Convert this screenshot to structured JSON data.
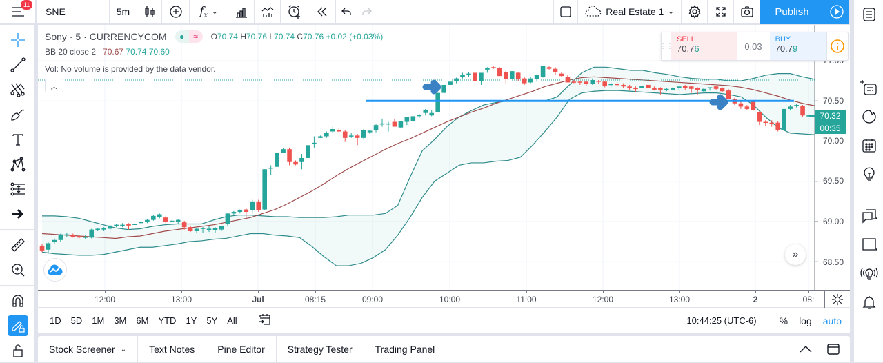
{
  "topbar": {
    "notification_count": "11",
    "symbol": "SNE",
    "interval": "5m",
    "layout_name": "Real Estate 1",
    "publish_label": "Publish"
  },
  "legend": {
    "title": "Sony · 5 · CURRENCYCOM",
    "ohlc": {
      "o_label": "O",
      "o": "70.74",
      "h_label": "H",
      "h": "70.76",
      "l_label": "L",
      "l": "70.74",
      "c_label": "C",
      "c": "70.76",
      "change": "+0.02 (+0.03%)"
    },
    "bb_label": "BB 20 close 2",
    "bb_values": [
      "70.67",
      "70.74",
      "70.60"
    ],
    "vol_text": "Vol: No volume is provided by the data vendor."
  },
  "trade": {
    "sell_label": "SELL",
    "sell_price_main": "70.7",
    "sell_price_last": "6",
    "spread": "0.03",
    "buy_label": "BUY",
    "buy_price_main": "70.7",
    "buy_price_last": "9",
    "zoom_in": "+",
    "zoom_out": "−"
  },
  "price_axis": {
    "labels": [
      "71.00",
      "70.50",
      "70.00",
      "69.50",
      "69.00",
      "68.50"
    ],
    "last_price": "70.32",
    "countdown": "00:35"
  },
  "time_axis": {
    "labels": [
      "12:00",
      "13:00",
      "Jul",
      "08:15",
      "09:00",
      "10:00",
      "11:00",
      "12:00",
      "13:00",
      "2",
      "08:"
    ]
  },
  "bottom": {
    "ranges": [
      "1D",
      "5D",
      "1M",
      "3M",
      "6M",
      "YTD",
      "1Y",
      "5Y",
      "All"
    ],
    "clock": "10:44:25 (UTC-6)",
    "percent": "%",
    "log": "log",
    "auto": "auto"
  },
  "panel_tabs": [
    "Stock Screener",
    "Text Notes",
    "Pine Editor",
    "Strategy Tester",
    "Trading Panel"
  ],
  "colors": {
    "up": "#26a69a",
    "down": "#ef5350",
    "accent": "#2196f3",
    "bb_basis": "#a04b4b",
    "bb_band": "#2e8b8b"
  },
  "chart_data": {
    "type": "candlestick",
    "title": "Sony · 5 · CURRENCYCOM",
    "ylim": [
      68.3,
      71.15
    ],
    "y_ticks": [
      71.0,
      70.5,
      70.0,
      69.5,
      69.0,
      68.5
    ],
    "horizontal_line": 70.5,
    "candles": [
      [
        68.7,
        68.72,
        68.62,
        68.64
      ],
      [
        68.65,
        68.74,
        68.6,
        68.73
      ],
      [
        68.75,
        68.79,
        68.72,
        68.77
      ],
      [
        68.77,
        68.85,
        68.75,
        68.84
      ],
      [
        68.83,
        68.86,
        68.81,
        68.84
      ],
      [
        68.83,
        68.85,
        68.8,
        68.81
      ],
      [
        68.82,
        68.83,
        68.79,
        68.8
      ],
      [
        68.8,
        68.83,
        68.78,
        68.81
      ],
      [
        68.8,
        68.91,
        68.79,
        68.9
      ],
      [
        68.9,
        68.92,
        68.88,
        68.91
      ],
      [
        68.9,
        68.93,
        68.88,
        68.92
      ],
      [
        68.91,
        68.95,
        68.85,
        68.95
      ],
      [
        68.95,
        68.97,
        68.93,
        68.96
      ],
      [
        68.96,
        68.98,
        68.93,
        68.96
      ],
      [
        68.97,
        68.98,
        68.9,
        68.95
      ],
      [
        68.96,
        68.98,
        68.94,
        68.97
      ],
      [
        68.98,
        69.01,
        68.96,
        69.0
      ],
      [
        69.0,
        69.03,
        68.98,
        69.02
      ],
      [
        69.02,
        69.08,
        69.01,
        69.07
      ],
      [
        69.06,
        69.1,
        69.04,
        69.09
      ],
      [
        69.05,
        69.07,
        68.98,
        69.0
      ],
      [
        69.0,
        69.02,
        68.99,
        69.01
      ],
      [
        69.0,
        69.03,
        68.97,
        69.02
      ],
      [
        68.99,
        69.01,
        68.9,
        68.93
      ],
      [
        68.93,
        68.95,
        68.87,
        68.88
      ],
      [
        68.88,
        68.92,
        68.86,
        68.91
      ],
      [
        68.91,
        68.93,
        68.86,
        68.92
      ],
      [
        68.9,
        68.94,
        68.87,
        68.91
      ],
      [
        68.89,
        68.93,
        68.86,
        68.92
      ],
      [
        68.9,
        68.95,
        68.88,
        68.94
      ],
      [
        68.97,
        69.1,
        68.95,
        69.1
      ],
      [
        69.1,
        69.13,
        69.08,
        69.12
      ],
      [
        69.12,
        69.15,
        69.1,
        69.14
      ],
      [
        69.15,
        69.17,
        69.05,
        69.12
      ],
      [
        69.14,
        69.27,
        69.11,
        69.25
      ],
      [
        69.25,
        69.27,
        69.12,
        69.14
      ],
      [
        69.15,
        69.65,
        69.14,
        69.65
      ],
      [
        69.66,
        69.7,
        69.58,
        69.67
      ],
      [
        69.68,
        69.85,
        69.68,
        69.85
      ],
      [
        69.85,
        69.91,
        69.85,
        69.9
      ],
      [
        69.9,
        69.92,
        69.7,
        69.74
      ],
      [
        69.74,
        69.76,
        69.7,
        69.71
      ],
      [
        69.74,
        69.84,
        69.65,
        69.79
      ],
      [
        69.79,
        69.95,
        69.79,
        69.95
      ],
      [
        69.98,
        70.06,
        69.92,
        69.98
      ],
      [
        70.04,
        70.07,
        70.04,
        70.06
      ],
      [
        70.06,
        70.12,
        70.04,
        70.1
      ],
      [
        70.12,
        70.18,
        70.1,
        70.15
      ],
      [
        70.14,
        70.17,
        70.11,
        70.12
      ],
      [
        70.12,
        70.14,
        69.99,
        70.04
      ],
      [
        70.06,
        70.1,
        70.04,
        70.07
      ],
      [
        70.07,
        70.09,
        69.95,
        70.04
      ],
      [
        70.04,
        70.15,
        70.02,
        70.14
      ],
      [
        70.11,
        70.14,
        70.09,
        70.13
      ],
      [
        70.14,
        70.21,
        70.11,
        70.2
      ],
      [
        70.22,
        70.28,
        70.18,
        70.22
      ],
      [
        70.22,
        70.24,
        70.12,
        70.22
      ],
      [
        70.24,
        70.28,
        70.18,
        70.18
      ],
      [
        70.17,
        70.25,
        70.16,
        70.25
      ],
      [
        70.24,
        70.26,
        70.2,
        70.3
      ],
      [
        70.25,
        70.3,
        70.24,
        70.31
      ],
      [
        70.31,
        70.34,
        70.29,
        70.33
      ],
      [
        70.35,
        70.4,
        70.32,
        70.39
      ],
      [
        70.32,
        70.39,
        70.31,
        70.35
      ],
      [
        70.36,
        70.6,
        70.36,
        70.6
      ],
      [
        70.6,
        70.7,
        70.59,
        70.7
      ],
      [
        70.7,
        70.75,
        70.7,
        70.74
      ],
      [
        70.75,
        70.79,
        70.72,
        70.78
      ],
      [
        70.8,
        70.85,
        70.78,
        70.82
      ],
      [
        70.84,
        70.86,
        70.8,
        70.84
      ],
      [
        70.85,
        70.85,
        70.7,
        70.75
      ],
      [
        70.75,
        70.84,
        70.7,
        70.85
      ],
      [
        70.89,
        70.92,
        70.85,
        70.91
      ],
      [
        70.92,
        70.93,
        70.9,
        70.91
      ],
      [
        70.91,
        70.92,
        70.81,
        70.81
      ],
      [
        70.86,
        70.88,
        70.72,
        70.77
      ],
      [
        70.77,
        70.87,
        70.77,
        70.87
      ],
      [
        70.85,
        70.86,
        70.75,
        70.77
      ],
      [
        70.78,
        70.8,
        70.7,
        70.72
      ],
      [
        70.73,
        70.8,
        70.72,
        70.78
      ],
      [
        70.77,
        70.83,
        70.74,
        70.82
      ],
      [
        70.8,
        70.94,
        70.79,
        70.94
      ],
      [
        70.92,
        70.93,
        70.89,
        70.9
      ],
      [
        70.9,
        70.92,
        70.82,
        70.86
      ],
      [
        70.84,
        70.86,
        70.8,
        70.81
      ],
      [
        70.8,
        70.82,
        70.73,
        70.73
      ],
      [
        70.74,
        70.76,
        70.72,
        70.73
      ],
      [
        70.74,
        70.75,
        70.7,
        70.73
      ],
      [
        70.74,
        70.75,
        70.69,
        70.71
      ],
      [
        70.71,
        70.78,
        70.7,
        70.76
      ],
      [
        70.75,
        70.76,
        70.71,
        70.74
      ],
      [
        70.74,
        70.75,
        70.67,
        70.69
      ],
      [
        70.7,
        70.73,
        70.67,
        70.71
      ],
      [
        70.71,
        70.73,
        70.68,
        70.7
      ],
      [
        70.7,
        70.72,
        70.66,
        70.68
      ],
      [
        70.68,
        70.7,
        70.63,
        70.66
      ],
      [
        70.66,
        70.68,
        70.61,
        70.65
      ],
      [
        70.66,
        70.71,
        70.64,
        70.69
      ],
      [
        70.7,
        70.71,
        70.59,
        70.66
      ],
      [
        70.66,
        70.68,
        70.63,
        70.64
      ],
      [
        70.66,
        70.67,
        70.58,
        70.64
      ],
      [
        70.64,
        70.66,
        70.62,
        70.65
      ],
      [
        70.64,
        70.67,
        70.63,
        70.66
      ],
      [
        70.66,
        70.68,
        70.63,
        70.68
      ],
      [
        70.69,
        70.7,
        70.64,
        70.66
      ],
      [
        70.68,
        70.69,
        70.6,
        70.65
      ],
      [
        70.66,
        70.67,
        70.58,
        70.64
      ],
      [
        70.62,
        70.66,
        70.61,
        70.65
      ],
      [
        70.66,
        70.67,
        70.63,
        70.67
      ],
      [
        70.68,
        70.69,
        70.64,
        70.65
      ],
      [
        70.66,
        70.67,
        70.61,
        70.62
      ],
      [
        70.63,
        70.65,
        70.55,
        70.52
      ],
      [
        70.52,
        70.54,
        70.45,
        70.47
      ],
      [
        70.47,
        70.49,
        70.4,
        70.43
      ],
      [
        70.43,
        70.45,
        70.39,
        70.4
      ],
      [
        70.49,
        70.5,
        70.38,
        70.39
      ],
      [
        70.36,
        70.37,
        70.2,
        70.24
      ],
      [
        70.24,
        70.26,
        70.19,
        70.23
      ],
      [
        70.23,
        70.26,
        70.18,
        70.22
      ],
      [
        70.23,
        70.25,
        70.12,
        70.14
      ],
      [
        70.14,
        70.4,
        70.13,
        70.4
      ],
      [
        70.4,
        70.45,
        70.38,
        70.43
      ],
      [
        70.44,
        70.46,
        70.42,
        70.45
      ],
      [
        70.44,
        70.45,
        70.3,
        70.32
      ],
      [
        70.32,
        70.33,
        70.31,
        70.32
      ]
    ],
    "bb_upper": [
      69.07,
      69.07,
      69.06,
      69.04,
      69.0,
      68.96,
      68.92,
      68.9,
      68.91,
      68.94,
      68.96,
      68.97,
      68.97,
      68.97,
      69.02,
      69.06,
      69.08,
      69.08,
      69.07,
      69.06,
      69.06,
      69.05,
      69.05,
      69.05,
      69.06,
      69.08,
      69.08,
      69.08,
      69.1,
      69.2,
      69.55,
      69.88,
      70.02,
      70.18,
      70.3,
      70.38,
      70.45,
      70.48,
      70.5,
      70.5,
      70.5,
      70.5,
      70.55,
      70.7,
      70.85,
      70.92,
      70.92,
      70.9,
      70.88,
      70.88,
      70.85,
      70.83,
      70.8,
      70.78,
      70.77,
      70.77,
      70.75,
      70.75,
      70.78,
      70.82,
      70.84,
      70.84,
      70.8,
      70.77
    ],
    "bb_basis": [
      68.85,
      68.84,
      68.83,
      68.82,
      68.81,
      68.8,
      68.79,
      68.81,
      68.82,
      68.85,
      68.88,
      68.9,
      68.92,
      68.94,
      68.96,
      68.99,
      69.02,
      69.05,
      69.1,
      69.15,
      69.22,
      69.3,
      69.38,
      69.47,
      69.57,
      69.66,
      69.74,
      69.82,
      69.9,
      69.97,
      70.03,
      70.1,
      70.17,
      70.24,
      70.3,
      70.36,
      70.41,
      70.47,
      70.52,
      70.57,
      70.62,
      70.68,
      70.72,
      70.76,
      70.79,
      70.8,
      70.79,
      70.78,
      70.77,
      70.76,
      70.75,
      70.74,
      70.73,
      70.72,
      70.71,
      70.7,
      70.69,
      70.67,
      70.64,
      70.6,
      70.56,
      70.51,
      70.47,
      70.44
    ],
    "bb_lower": [
      68.62,
      68.6,
      68.59,
      68.58,
      68.58,
      68.59,
      68.62,
      68.65,
      68.68,
      68.68,
      68.7,
      68.72,
      68.75,
      68.76,
      68.78,
      68.79,
      68.82,
      68.85,
      68.85,
      68.83,
      68.82,
      68.8,
      68.69,
      68.56,
      68.45,
      68.45,
      68.48,
      68.55,
      68.65,
      68.83,
      69.05,
      69.3,
      69.5,
      69.6,
      69.7,
      69.73,
      69.73,
      69.75,
      69.76,
      69.8,
      69.95,
      70.12,
      70.3,
      70.52,
      70.6,
      70.62,
      70.63,
      70.63,
      70.62,
      70.61,
      70.6,
      70.59,
      70.58,
      70.59,
      70.6,
      70.6,
      70.58,
      70.55,
      70.45,
      70.3,
      70.17,
      70.1,
      70.09,
      70.08
    ]
  }
}
